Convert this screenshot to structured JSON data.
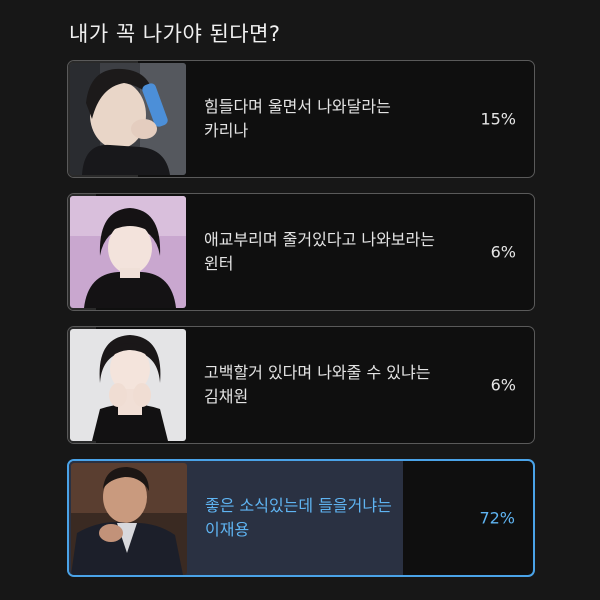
{
  "poll": {
    "question": "내가 꼭 나가야 된다면?",
    "options": [
      {
        "line1": "힘들다며 울면서 나와달라는",
        "line2": "카리나",
        "percent": "15%",
        "fill": 0.15,
        "selected": false,
        "image": "karina-photo"
      },
      {
        "line1": "애교부리며 줄거있다고 나와보라는",
        "line2": "윈터",
        "percent": "6%",
        "fill": 0.06,
        "selected": false,
        "image": "winter-photo"
      },
      {
        "line1": "고백할거 있다며 나와줄 수 있냐는",
        "line2": "김채원",
        "percent": "6%",
        "fill": 0.06,
        "selected": false,
        "image": "chaewon-photo"
      },
      {
        "line1": "좋은 소식있는데 들을거냐는",
        "line2": "이재용",
        "percent": "72%",
        "fill": 0.72,
        "selected": true,
        "image": "jaeyong-photo"
      }
    ]
  },
  "colors": {
    "background": "#171717",
    "border": "#5a5a5a",
    "selected_border": "#4aa3e8",
    "selected_text": "#5fb4f2"
  }
}
